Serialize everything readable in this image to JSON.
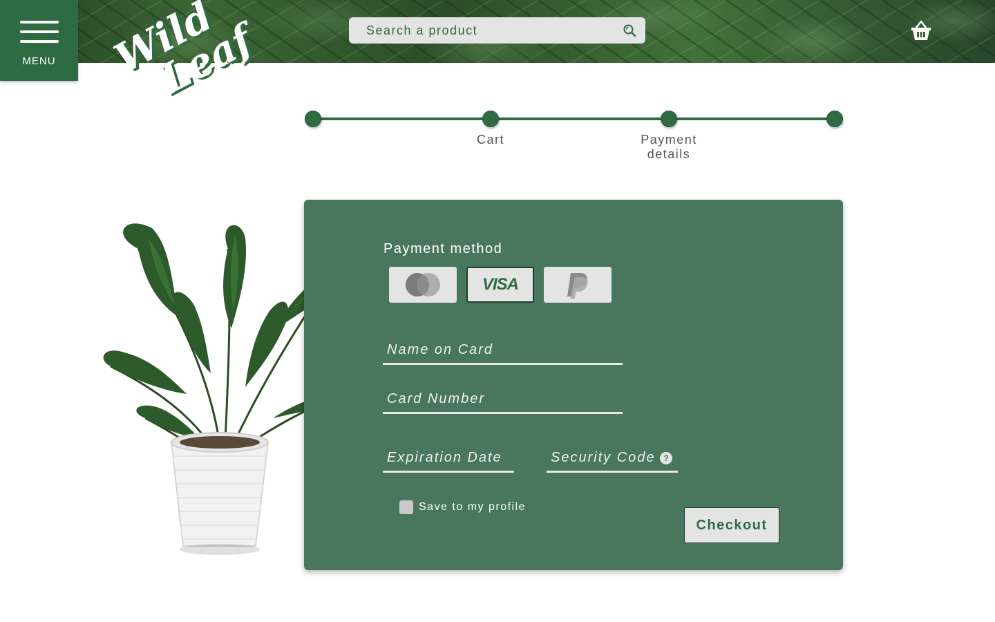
{
  "header": {
    "menu_label": "MENU",
    "logo_line1": "Wild",
    "logo_line2": "Leaf",
    "search_placeholder": "Search a product",
    "search_icon": "search-icon",
    "basket_icon": "basket-icon"
  },
  "stepper": {
    "steps": [
      {
        "label": ""
      },
      {
        "label": "Cart"
      },
      {
        "label": "Payment details"
      },
      {
        "label": ""
      }
    ]
  },
  "payment": {
    "title": "Payment method",
    "methods": [
      {
        "name": "mastercard",
        "selected": false
      },
      {
        "name": "visa",
        "label": "VISA",
        "selected": true
      },
      {
        "name": "paypal",
        "selected": false
      }
    ],
    "name_on_card_placeholder": "Name on Card",
    "card_number_placeholder": "Card Number",
    "expiration_placeholder": "Expiration Date",
    "security_code_placeholder": "Security Code",
    "help_glyph": "?",
    "save_label": "Save to my profile",
    "checkout_label": "Checkout"
  },
  "colors": {
    "brand_green": "#2e6b43",
    "panel_green": "#48775e",
    "light_gray": "#e4e4e4"
  }
}
